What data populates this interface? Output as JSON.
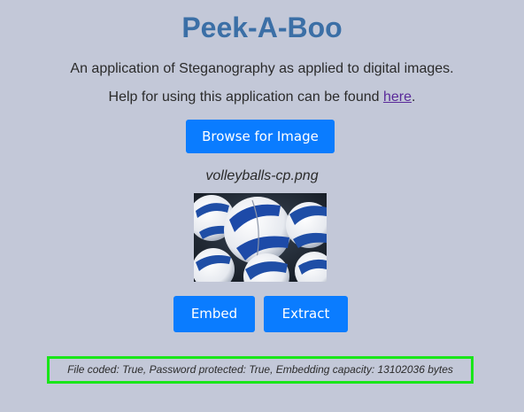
{
  "header": {
    "title": "Peek-A-Boo",
    "subtitle": "An application of Steganography as applied to digital images.",
    "help_prefix": "Help for using this application can be found ",
    "help_link": "here",
    "help_suffix": "."
  },
  "controls": {
    "browse_label": "Browse for Image",
    "embed_label": "Embed",
    "extract_label": "Extract"
  },
  "file": {
    "name": "volleyballs-cp.png"
  },
  "status": {
    "text": "File coded: True, Password protected: True, Embedding capacity: 13102036 bytes"
  },
  "colors": {
    "background": "#c3c8d8",
    "title": "#3b6fa6",
    "button": "#0a7cff",
    "status_border": "#19e619",
    "link": "#5a2a9a"
  }
}
